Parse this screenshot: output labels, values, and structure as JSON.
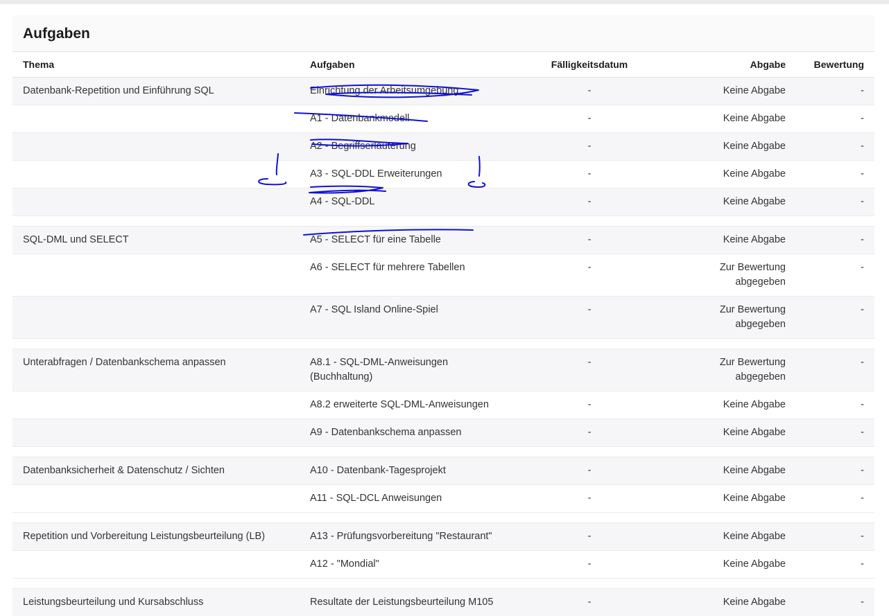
{
  "title": "Aufgaben",
  "columns": {
    "thema": "Thema",
    "aufgaben": "Aufgaben",
    "faelligkeit": "Fälligkeitsdatum",
    "abgabe": "Abgabe",
    "bewertung": "Bewertung"
  },
  "groups": [
    {
      "thema": "Datenbank-Repetition und Einführung SQL",
      "rows": [
        {
          "aufgabe": "Einrichtung der Arbeitsumgebung",
          "faellig": "-",
          "abgabe": "Keine Abgabe",
          "bewertung": "-"
        },
        {
          "aufgabe": "A1 - Datenbankmodell",
          "faellig": "-",
          "abgabe": "Keine Abgabe",
          "bewertung": "-"
        },
        {
          "aufgabe": "A2 - Begriffserläuterung",
          "faellig": "-",
          "abgabe": "Keine Abgabe",
          "bewertung": "-"
        },
        {
          "aufgabe": "A3 - SQL-DDL Erweiterungen",
          "faellig": "-",
          "abgabe": "Keine Abgabe",
          "bewertung": "-"
        },
        {
          "aufgabe": "A4 - SQL-DDL",
          "faellig": "-",
          "abgabe": "Keine Abgabe",
          "bewertung": "-"
        }
      ]
    },
    {
      "thema": "SQL-DML und SELECT",
      "rows": [
        {
          "aufgabe": "A5 - SELECT für eine Tabelle",
          "faellig": "-",
          "abgabe": "Keine Abgabe",
          "bewertung": "-"
        },
        {
          "aufgabe": "A6 - SELECT für mehrere Tabellen",
          "faellig": "-",
          "abgabe": "Zur Bewertung abgegeben",
          "bewertung": "-"
        },
        {
          "aufgabe": "A7 - SQL Island Online-Spiel",
          "faellig": "-",
          "abgabe": "Zur Bewertung abgegeben",
          "bewertung": "-"
        }
      ]
    },
    {
      "thema": "Unterabfragen / Datenbankschema anpassen",
      "rows": [
        {
          "aufgabe": "A8.1 - SQL-DML-Anweisungen (Buchhaltung)",
          "faellig": "-",
          "abgabe": "Zur Bewertung abgegeben",
          "bewertung": "-"
        },
        {
          "aufgabe": "A8.2 erweiterte SQL-DML-Anweisungen",
          "faellig": "-",
          "abgabe": "Keine Abgabe",
          "bewertung": "-"
        },
        {
          "aufgabe": "A9 - Datenbankschema anpassen",
          "faellig": "-",
          "abgabe": "Keine Abgabe",
          "bewertung": "-"
        }
      ]
    },
    {
      "thema": "Datenbanksicherheit & Datenschutz / Sichten",
      "rows": [
        {
          "aufgabe": "A10 - Datenbank-Tagesprojekt",
          "faellig": "-",
          "abgabe": "Keine Abgabe",
          "bewertung": "-"
        },
        {
          "aufgabe": "A11 - SQL-DCL Anweisungen",
          "faellig": "-",
          "abgabe": "Keine Abgabe",
          "bewertung": "-"
        }
      ]
    },
    {
      "thema": "Repetition und Vorbereitung Leistungsbeurteilung (LB)",
      "rows": [
        {
          "aufgabe": "A13 - Prüfungsvorbereitung \"Restaurant\"",
          "faellig": "-",
          "abgabe": "Keine Abgabe",
          "bewertung": "-"
        },
        {
          "aufgabe": "A12 - \"Mondial\"",
          "faellig": "-",
          "abgabe": "Keine Abgabe",
          "bewertung": "-"
        }
      ]
    },
    {
      "thema": "Leistungsbeurteilung und Kursabschluss",
      "rows": [
        {
          "aufgabe": "Resultate der Leistungsbeurteilung M105",
          "faellig": "-",
          "abgabe": "Keine Abgabe",
          "bewertung": "-"
        }
      ]
    }
  ],
  "colors": {
    "annotation": "#1010d8",
    "row_shade": "#f6f6f8"
  }
}
